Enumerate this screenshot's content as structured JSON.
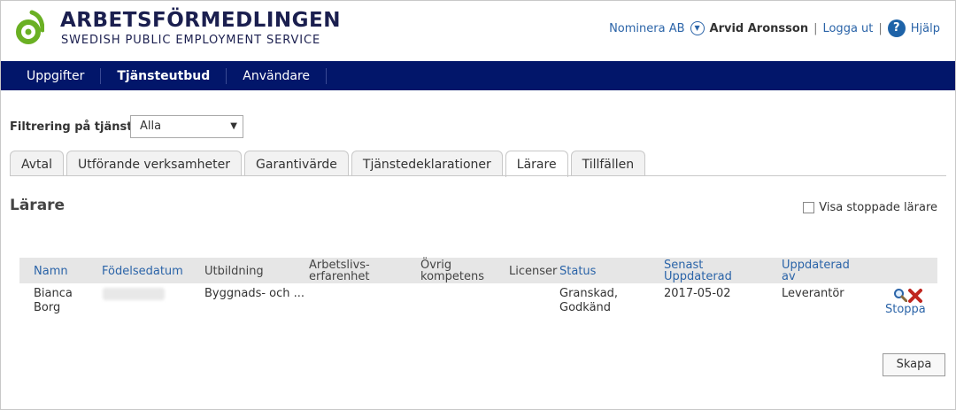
{
  "brand": {
    "name": "ARBETSFÖRMEDLINGEN",
    "subtitle": "SWEDISH PUBLIC EMPLOYMENT SERVICE",
    "logo_color": "#6ab023"
  },
  "userbar": {
    "org": "Nominera AB",
    "user": "Arvid Aronsson",
    "logout": "Logga ut",
    "help": "Hjälp",
    "separator": "|"
  },
  "nav": {
    "items": [
      "Uppgifter",
      "Tjänsteutbud",
      "Användare"
    ],
    "active": "Tjänsteutbud",
    "bg": "#02166a"
  },
  "filter": {
    "label": "Filtrering på tjänst",
    "value": "Alla"
  },
  "tabs": [
    "Avtal",
    "Utförande verksamheter",
    "Garantivärde",
    "Tjänstedeklarationer",
    "Lärare",
    "Tillfällen"
  ],
  "active_tab": "Lärare",
  "section": {
    "title": "Lärare",
    "show_stopped": "Visa stoppade lärare"
  },
  "table": {
    "headers": {
      "namn": "Namn",
      "fodelsedatum": "Födelsedatum",
      "utbildning": "Utbildning",
      "arbetsliv_1": "Arbetslivs-",
      "arbetsliv_2": "erfarenhet",
      "ovrig_1": "Övrig",
      "ovrig_2": "kompetens",
      "licenser": "Licenser",
      "status": "Status",
      "senast_1": "Senast",
      "senast_2": "Uppdaterad",
      "uppd_1": "Uppdaterad",
      "uppd_2": "av"
    },
    "rows": [
      {
        "namn_1": "Bianca",
        "namn_2": "Borg",
        "utbildning": "Byggnads- och ...",
        "status_1": "Granskad,",
        "status_2": "Godkänd",
        "senast": "2017-05-02",
        "uppdaterad_av": "Leverantör",
        "action": "Stoppa"
      }
    ]
  },
  "create_button": "Skapa"
}
